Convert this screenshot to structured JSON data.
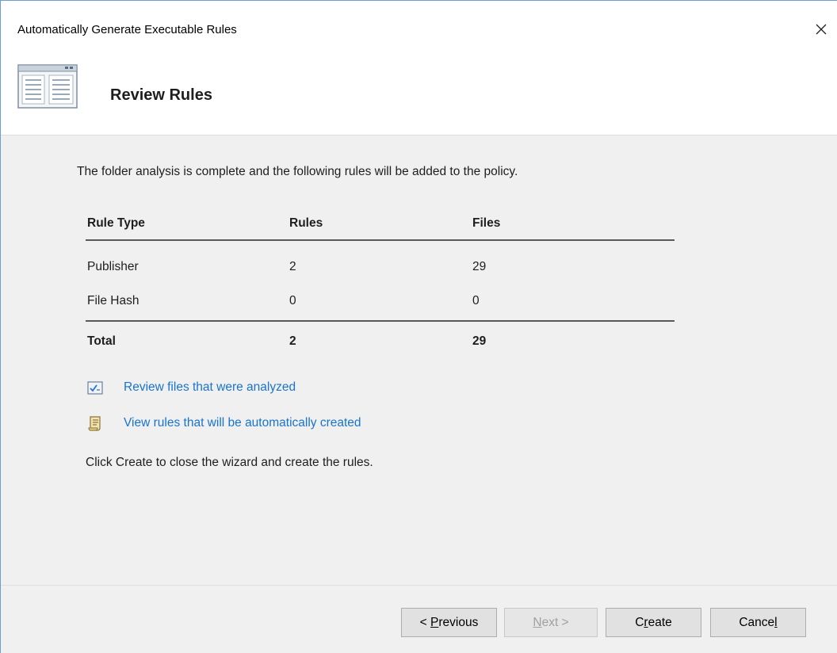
{
  "window": {
    "title": "Automatically Generate Executable Rules"
  },
  "header": {
    "title": "Review Rules",
    "icon": "wizard-page-icon"
  },
  "content": {
    "intro": "The folder analysis is complete and the following rules will be added to the policy.",
    "table": {
      "columns": [
        "Rule Type",
        "Rules",
        "Files"
      ],
      "rows": [
        [
          "Publisher",
          "2",
          "29"
        ],
        [
          "File Hash",
          "0",
          "0"
        ]
      ],
      "total": [
        "Total",
        "2",
        "29"
      ]
    },
    "links": [
      {
        "label": "Review files that were analyzed",
        "icon": "checklist-icon"
      },
      {
        "label": "View rules that will be automatically created",
        "icon": "scroll-icon"
      }
    ],
    "instruction": "Click Create to close the wizard and create the rules."
  },
  "buttons": {
    "previous": {
      "prefix": "< ",
      "mnemonic": "P",
      "rest": "revious"
    },
    "next": {
      "mnemonic": "N",
      "rest": "ext >"
    },
    "create": {
      "before": "C",
      "mnemonic": "r",
      "rest": "eate"
    },
    "cancel": {
      "before": "Cance",
      "mnemonic": "l"
    }
  },
  "colors": {
    "link": "#1874cd",
    "border": "#6c9cd4"
  }
}
